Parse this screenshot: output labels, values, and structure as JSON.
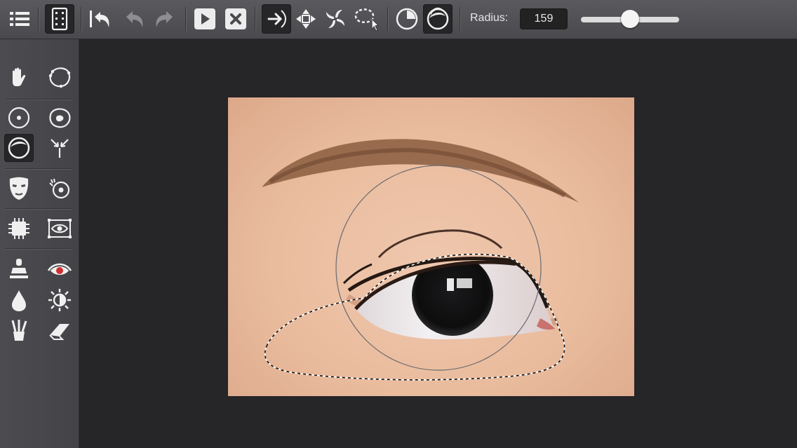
{
  "toolbar": {
    "buttons": [
      {
        "name": "menu-button",
        "icon": "list-icon"
      },
      {
        "name": "toggle-panel-button",
        "icon": "panel-icon"
      },
      {
        "name": "revert-button",
        "icon": "revert-icon"
      },
      {
        "name": "undo-button",
        "icon": "undo-icon"
      },
      {
        "name": "redo-button",
        "icon": "redo-icon"
      },
      {
        "name": "apply-button",
        "icon": "play-icon"
      },
      {
        "name": "cancel-button",
        "icon": "close-icon"
      },
      {
        "name": "forward-warp-button",
        "icon": "push-arrow-icon"
      },
      {
        "name": "pinch-button",
        "icon": "pinch-icon"
      },
      {
        "name": "twirl-button",
        "icon": "twirl-icon"
      },
      {
        "name": "lasso-select-button",
        "icon": "lasso-icon"
      },
      {
        "name": "brush-mode-1-button",
        "icon": "brush-circle-icon"
      },
      {
        "name": "brush-mode-2-button",
        "icon": "brush-circle-active-icon"
      }
    ],
    "radius_label": "Radius:",
    "radius_value": "159",
    "radius_slider_fraction": 0.5
  },
  "sidebar": {
    "tools": [
      {
        "name": "hand-tool",
        "icon": "hand-icon"
      },
      {
        "name": "freeform-select-tool",
        "icon": "freeform-select-icon"
      },
      {
        "name": "circle-select-tool",
        "icon": "circle-target-icon"
      },
      {
        "name": "blob-tool",
        "icon": "blob-icon"
      },
      {
        "name": "shrink-tool",
        "icon": "brush-circle-icon"
      },
      {
        "name": "pinch-tool",
        "icon": "pinch-arrows-icon"
      },
      {
        "name": "face-mask-tool",
        "icon": "mask-icon"
      },
      {
        "name": "spot-heal-tool",
        "icon": "spot-heal-icon"
      },
      {
        "name": "chip-tool",
        "icon": "chip-icon"
      },
      {
        "name": "eye-frame-tool",
        "icon": "eye-frame-icon"
      },
      {
        "name": "stamp-tool",
        "icon": "stamp-icon"
      },
      {
        "name": "red-eye-tool",
        "icon": "red-eye-icon"
      },
      {
        "name": "blur-tool",
        "icon": "drop-icon"
      },
      {
        "name": "brightness-tool",
        "icon": "sun-icon"
      },
      {
        "name": "brush-tool",
        "icon": "brush-cup-icon"
      },
      {
        "name": "eraser-tool",
        "icon": "eraser-icon"
      }
    ]
  },
  "canvas": {
    "subject": "eye-closeup-image"
  },
  "colors": {
    "toolbar_bg": "#4f4f53",
    "workspace_bg": "#262528",
    "active_bg": "#262628",
    "icon": "#f0f0f0",
    "icon_dim": "#9a9a9a",
    "red_accent": "#d23030"
  }
}
